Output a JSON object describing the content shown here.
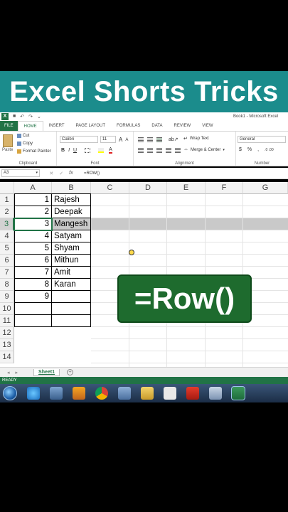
{
  "banner": {
    "title": "Excel Shorts Tricks"
  },
  "window": {
    "title": "Book1 - Microsoft Excel",
    "app_icon": "excel-icon"
  },
  "ribbon_tabs": [
    "FILE",
    "HOME",
    "INSERT",
    "PAGE LAYOUT",
    "FORMULAS",
    "DATA",
    "REVIEW",
    "VIEW"
  ],
  "ribbon": {
    "clipboard": {
      "paste": "Paste",
      "cut": "Cut",
      "copy": "Copy",
      "format_painter": "Format Painter",
      "label": "Clipboard"
    },
    "font": {
      "name": "Calibri",
      "size": "11",
      "grow": "A",
      "shrink": "A",
      "bold": "B",
      "italic": "I",
      "underline": "U",
      "label": "Font"
    },
    "alignment": {
      "wrap_text": "Wrap Text",
      "merge_center": "Merge & Center",
      "label": "Alignment"
    },
    "number": {
      "format": "General",
      "currency": "$",
      "percent": "%",
      "comma": ",",
      "label": "Number"
    }
  },
  "formula_bar": {
    "name_box": "A3",
    "cancel": "✕",
    "enter": "✓",
    "fx": "fx",
    "formula": "=ROW()"
  },
  "columns": [
    "A",
    "B",
    "C",
    "D",
    "E",
    "F",
    "G"
  ],
  "rows": [
    "1",
    "2",
    "3",
    "4",
    "5",
    "6",
    "7",
    "8",
    "9",
    "10",
    "11",
    "12",
    "13",
    "14"
  ],
  "table": [
    {
      "a": "1",
      "b": "Rajesh"
    },
    {
      "a": "2",
      "b": "Deepak"
    },
    {
      "a": "3",
      "b": "Mangesh"
    },
    {
      "a": "4",
      "b": "Satyam"
    },
    {
      "a": "5",
      "b": "Shyam"
    },
    {
      "a": "6",
      "b": "Mithun"
    },
    {
      "a": "7",
      "b": "Amit"
    },
    {
      "a": "8",
      "b": "Karan"
    },
    {
      "a": "9",
      "b": ""
    },
    {
      "a": "",
      "b": ""
    },
    {
      "a": "",
      "b": ""
    }
  ],
  "overlay": {
    "text": "=Row()"
  },
  "sheets": {
    "active": "Sheet1",
    "add": "+"
  },
  "status": "READY",
  "colors": {
    "excel_green": "#217346",
    "banner": "#1b8c8c",
    "overlay": "#1e6b2e"
  }
}
